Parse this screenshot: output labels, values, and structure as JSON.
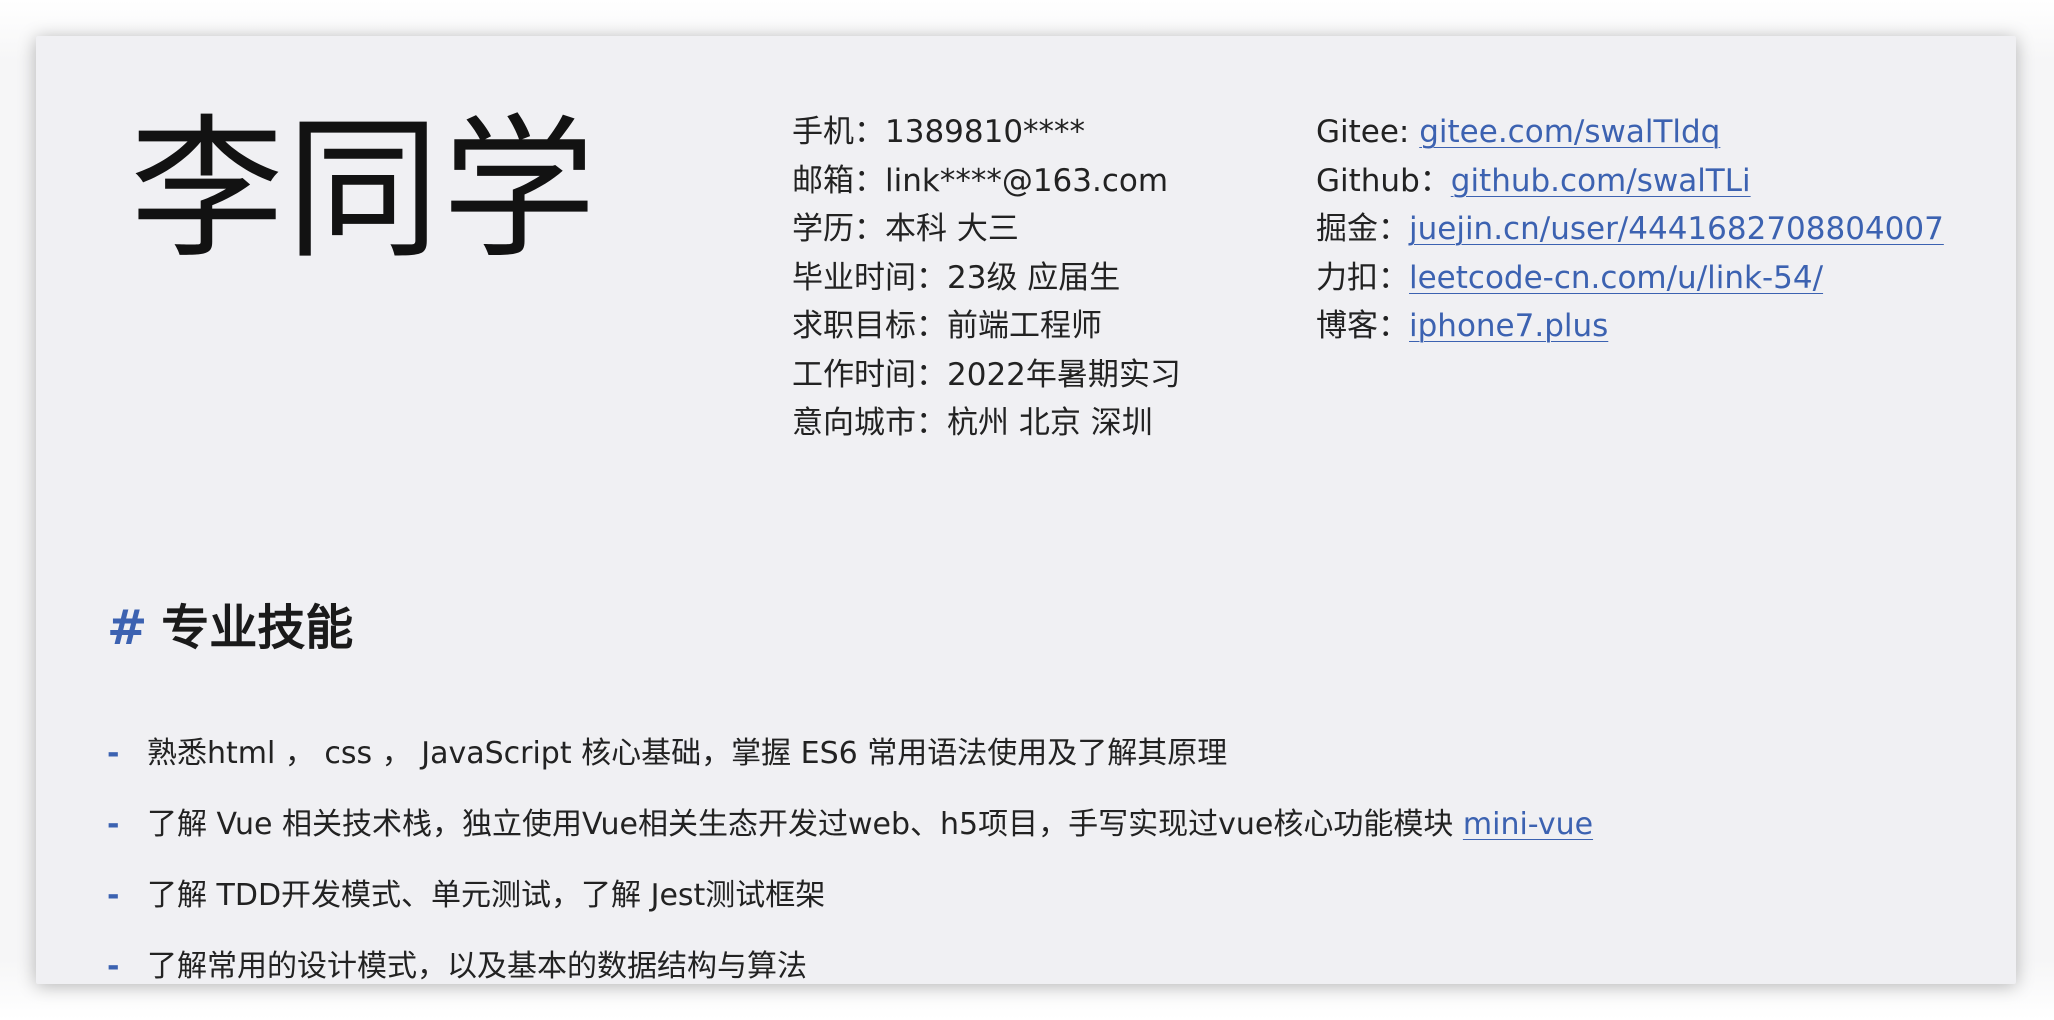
{
  "resume": {
    "name": "李同学",
    "contact": [
      "手机：1389810****",
      "邮箱：link****@163.com",
      "学历：本科 大三",
      "毕业时间：23级 应届生",
      "求职目标：前端工程师",
      "工作时间：2022年暑期实习",
      "意向城市：杭州 北京 深圳"
    ],
    "links": [
      {
        "label": "Gitee: ",
        "url": "gitee.com/swalTldq"
      },
      {
        "label": "Github：",
        "url": "github.com/swalTLi"
      },
      {
        "label": "掘金：",
        "url": "juejin.cn/user/4441682708804007"
      },
      {
        "label": "力扣：",
        "url": "leetcode-cn.com/u/link-54/"
      },
      {
        "label": "博客：",
        "url": "iphone7.plus"
      }
    ],
    "skills_section": {
      "hash": "#",
      "title": "专业技能",
      "items": [
        {
          "text": "熟悉html ， css ， JavaScript 核心基础，掌握 ES6 常用语法使用及了解其原理",
          "link": ""
        },
        {
          "text": "了解 Vue 相关技术栈，独立使用Vue相关生态开发过web、h5项目，手写实现过vue核心功能模块 ",
          "link": "mini-vue"
        },
        {
          "text": "了解 TDD开发模式、单元测试，了解 Jest测试框架",
          "link": ""
        },
        {
          "text": "了解常用的设计模式，以及基本的数据结构与算法",
          "link": ""
        }
      ]
    },
    "bullet": "-"
  }
}
